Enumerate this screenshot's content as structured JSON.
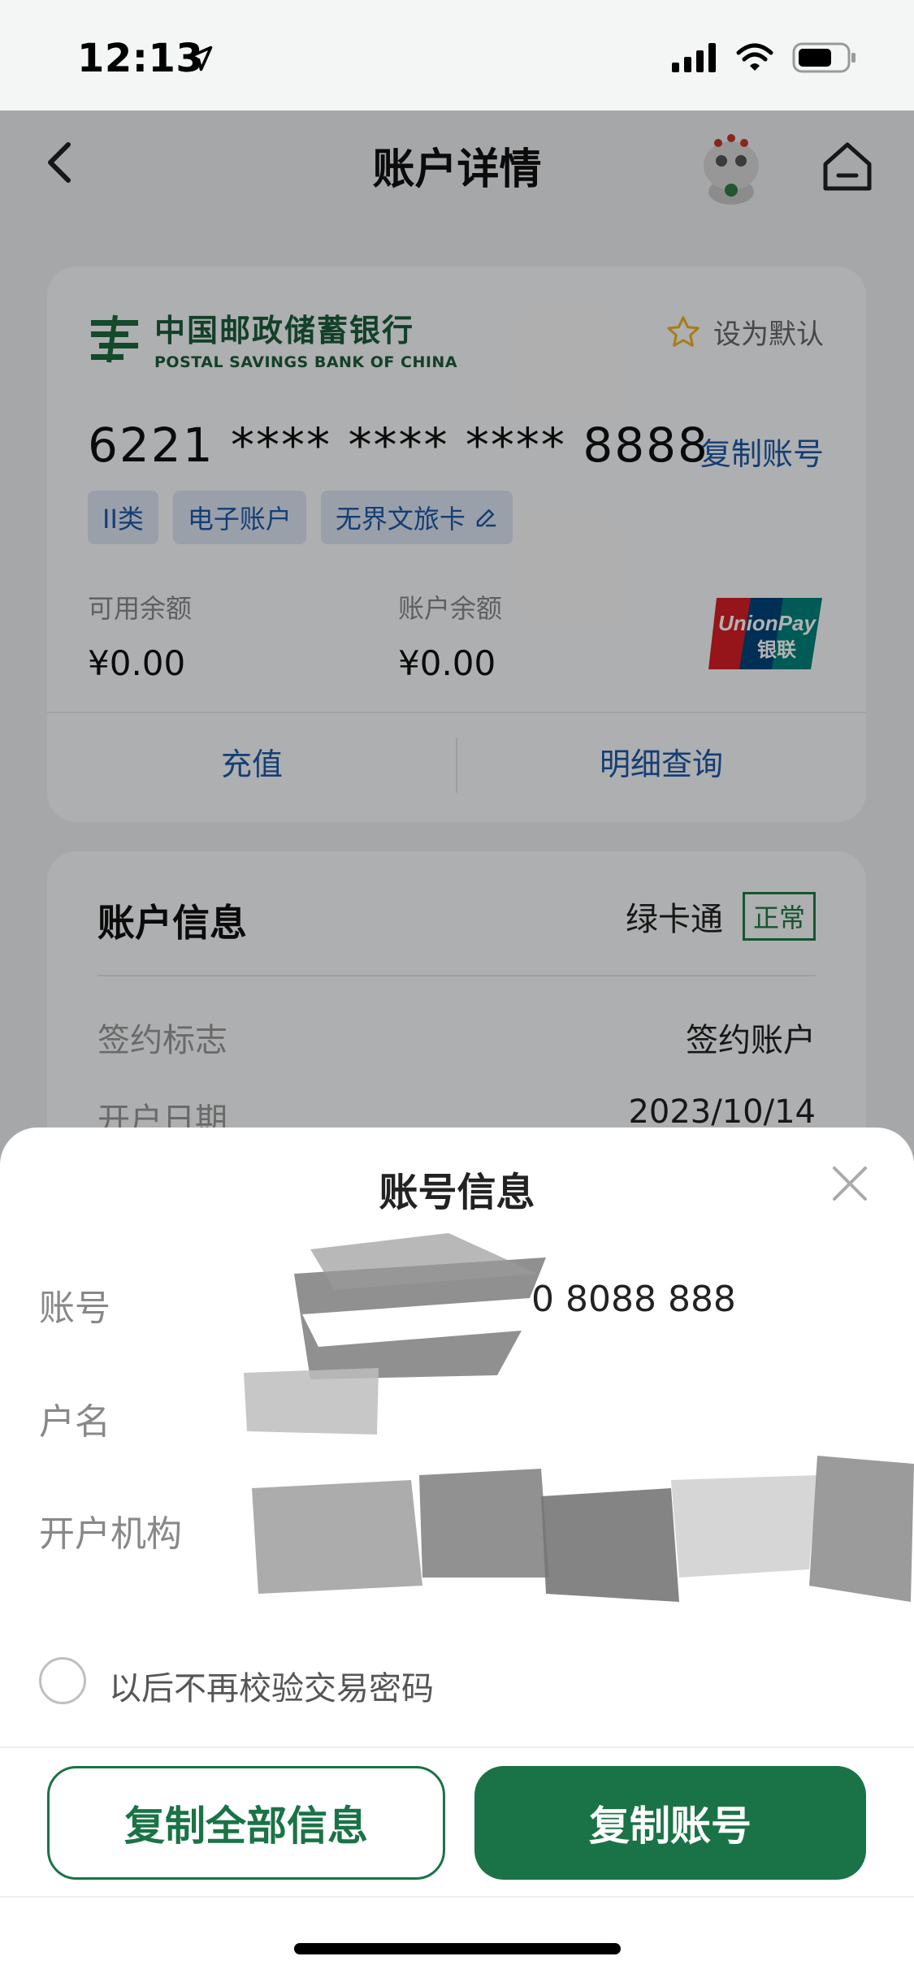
{
  "status_bar": {
    "time": "12:13"
  },
  "nav": {
    "title": "账户详情"
  },
  "card": {
    "bank_name_cn": "中国邮政储蓄银行",
    "bank_name_en": "POSTAL SAVINGS BANK OF CHINA",
    "set_default": "设为默认",
    "number": "6221 **** **** **** 8888",
    "copy_account": "复制账号",
    "tags": [
      "II类",
      "电子账户",
      "无界文旅卡"
    ],
    "available_label": "可用余额",
    "available_value": "¥0.00",
    "balance_label": "账户余额",
    "balance_value": "¥0.00",
    "unionpay_en": "UnionPay",
    "unionpay_cn": "银联",
    "action_recharge": "充值",
    "action_details": "明细查询"
  },
  "account_info": {
    "title": "账户信息",
    "product": "绿卡通",
    "status": "正常",
    "rows": [
      {
        "key": "签约标志",
        "value": "签约账户"
      },
      {
        "key": "开户日期",
        "value": "2023/10/14"
      }
    ]
  },
  "sheet": {
    "title": "账号信息",
    "account_label": "账号",
    "account_value": "0 8088 888",
    "name_label": "户名",
    "branch_label": "开户机构",
    "checkbox_label": "以后不再校验交易密码",
    "copy_all": "复制全部信息",
    "copy_account": "复制账号"
  },
  "colors": {
    "brand_green": "#1a7346",
    "link_blue": "#1e5aa8",
    "star": "#f0b429"
  }
}
